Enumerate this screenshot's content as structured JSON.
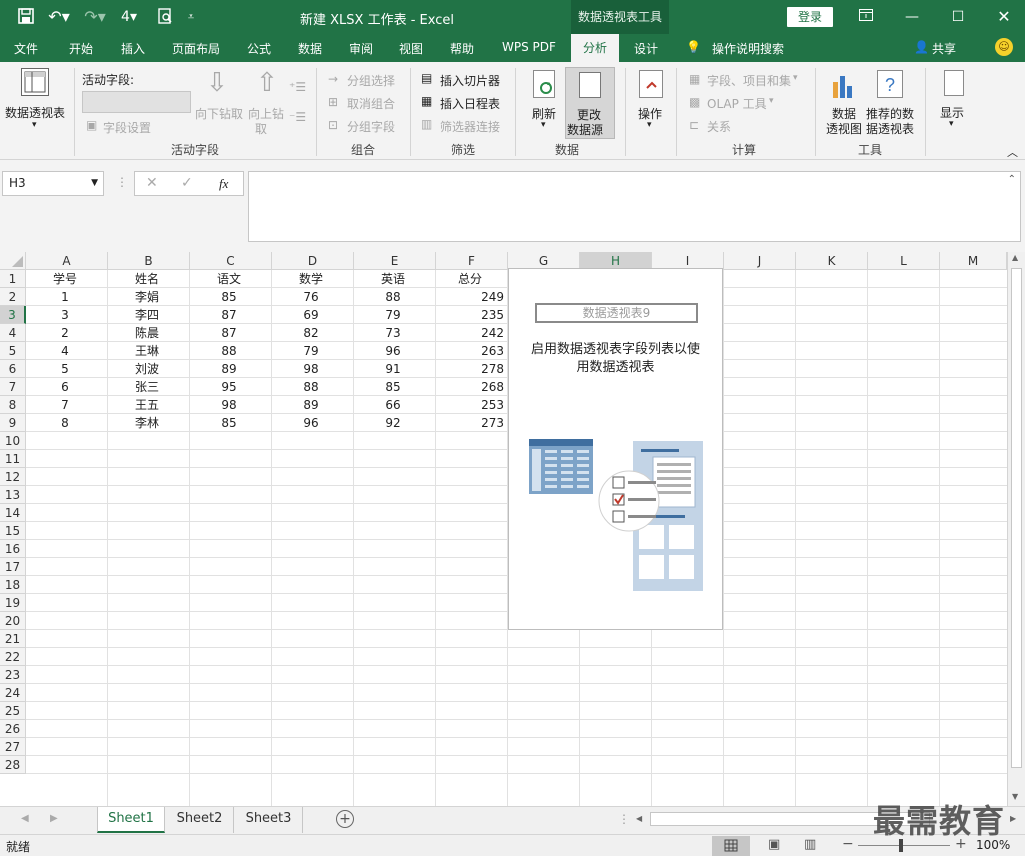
{
  "title_bar": {
    "title": "新建 XLSX 工作表  -  Excel",
    "context_tool": "数据透视表工具",
    "login": "登录"
  },
  "menu": {
    "items": [
      "文件",
      "开始",
      "插入",
      "页面布局",
      "公式",
      "数据",
      "审阅",
      "视图",
      "帮助",
      "WPS PDF",
      "分析",
      "设计"
    ],
    "active": "分析",
    "search": "操作说明搜索",
    "share": "共享"
  },
  "ribbon": {
    "pivot_table": "数据透视表",
    "active_field_label": "活动字段:",
    "field_settings": "字段设置",
    "drill_down": [
      "向下钻取"
    ],
    "drill_up": [
      "向上钻",
      "取"
    ],
    "group_active_field": "活动字段",
    "group_selection": "分组选择",
    "ungroup": "取消组合",
    "group_field": "分组字段",
    "group_group": "组合",
    "insert_slicer": "插入切片器",
    "insert_timeline": "插入日程表",
    "filter_connections": "筛选器连接",
    "group_filter": "筛选",
    "refresh": "刷新",
    "change_source": [
      "更改",
      "数据源"
    ],
    "group_data": "数据",
    "actions": "操作",
    "fields_items_sets": "字段、项目和集",
    "olap_tools": "OLAP 工具",
    "relationships": "关系",
    "group_calc": "计算",
    "pivot_chart": [
      "数据",
      "透视图"
    ],
    "recommended": [
      "推荐的数",
      "据透视表"
    ],
    "group_tools": "工具",
    "show": "显示"
  },
  "formula_bar": {
    "name_box": "H3",
    "fx": "fx"
  },
  "grid": {
    "columns": [
      "A",
      "B",
      "C",
      "D",
      "E",
      "F",
      "G",
      "H",
      "I",
      "J",
      "K",
      "L",
      "M"
    ],
    "rows": [
      "1",
      "2",
      "3",
      "4",
      "5",
      "6",
      "7",
      "8",
      "9",
      "10",
      "11",
      "12",
      "13",
      "14",
      "15",
      "16",
      "17",
      "18",
      "19",
      "20",
      "21",
      "22",
      "23",
      "24",
      "25",
      "26",
      "27",
      "28"
    ],
    "headers": [
      "学号",
      "姓名",
      "语文",
      "数学",
      "英语",
      "总分"
    ],
    "data": [
      [
        "1",
        "李娟",
        "85",
        "76",
        "88",
        "249"
      ],
      [
        "3",
        "李四",
        "87",
        "69",
        "79",
        "235"
      ],
      [
        "2",
        "陈晨",
        "87",
        "82",
        "73",
        "242"
      ],
      [
        "4",
        "王琳",
        "88",
        "79",
        "96",
        "263"
      ],
      [
        "5",
        "刘波",
        "89",
        "98",
        "91",
        "278"
      ],
      [
        "6",
        "张三",
        "95",
        "88",
        "85",
        "268"
      ],
      [
        "7",
        "王五",
        "98",
        "89",
        "66",
        "253"
      ],
      [
        "8",
        "李林",
        "85",
        "96",
        "92",
        "273"
      ]
    ]
  },
  "pivot_panel": {
    "name": "数据透视表9",
    "hint": [
      "启用数据透视表字段列表以使",
      "用数据透视表"
    ]
  },
  "sheets": [
    "Sheet1",
    "Sheet2",
    "Sheet3"
  ],
  "active_sheet": "Sheet1",
  "status": {
    "ready": "就绪",
    "zoom": "100%"
  },
  "watermark": "最需教育",
  "colors": {
    "excel_green": "#217346",
    "selection": "#217346"
  }
}
